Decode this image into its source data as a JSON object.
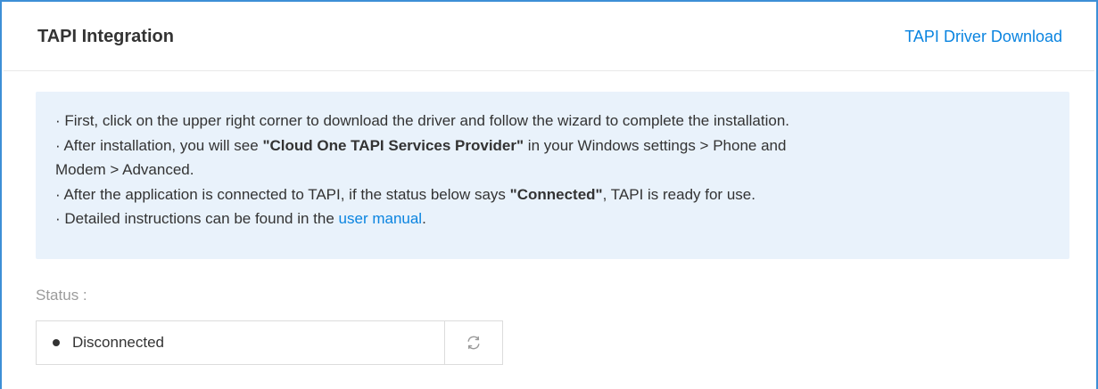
{
  "header": {
    "title": "TAPI Integration",
    "download_link": "TAPI Driver Download"
  },
  "info": {
    "line1": "· First, click on the upper right corner to download the driver and follow the wizard to complete the installation.",
    "line2_prefix": "· After installation, you will see ",
    "line2_bold": "\"Cloud One TAPI Services Provider\"",
    "line2_suffix": " in your Windows settings > Phone and",
    "line3": "Modem > Advanced.",
    "line4_prefix": "· After the application is connected to TAPI, if the status below says ",
    "line4_bold": "\"Connected\"",
    "line4_suffix": ", TAPI is ready for use.",
    "line5_prefix": "· Detailed instructions can be found in the ",
    "line5_link": "user manual",
    "line5_suffix": "."
  },
  "status": {
    "label": "Status :",
    "value": "Disconnected",
    "dot_color": "#333333",
    "refresh_icon": "refresh-icon"
  },
  "colors": {
    "accent": "#0a84e0",
    "frame_border": "#3d8fd6",
    "info_bg": "#e9f2fb"
  }
}
